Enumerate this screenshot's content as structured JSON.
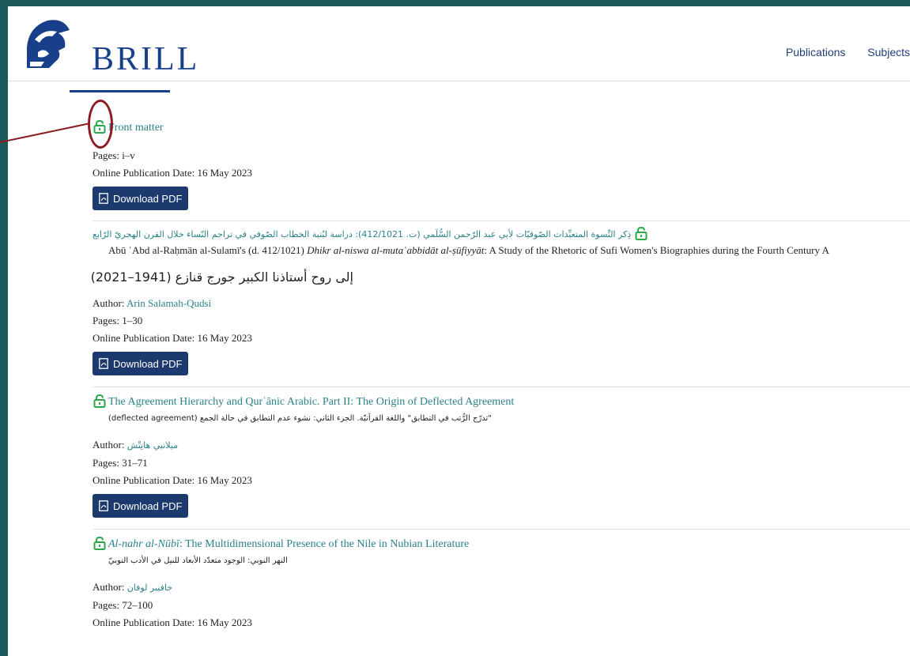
{
  "header": {
    "logo_text": "BRILL",
    "nav": [
      "Publications",
      "Subjects"
    ]
  },
  "entries": [
    {
      "title": "Front matter",
      "pages": "Pages:  i–v",
      "date": "Online Publication Date:  16 May 2023",
      "download_label": "Download PDF"
    },
    {
      "title_ar": "ذِكر النِّسوة المتعبِّدات الصّوفيّات لأبي عبد الرّحمن السُّلَمي (ت. 412/1021): دراسة لبُنية الخطاب الصّوفي في تراجم النّساء خلال القرن الهجريّ الرّابع",
      "subtitle": "Abū ʿAbd al-Raḥmān al-Sulamī's (d. 412/1021) ",
      "subtitle_italic": "Dhikr al-niswa al-mutaʿabbidāt al-ṣūfiyyāt",
      "subtitle_rest": ": A Study of the Rhetoric of Sufi Women's Biographies during the Fourth Century A",
      "dedication": "إلى روح أستاذنا الكبير جورج قنازع (1941–2021)",
      "author_label": "Author: ",
      "author": "Arin Salamah-Qudsi",
      "pages": "Pages:  1–30",
      "date": "Online Publication Date:  16 May 2023",
      "download_label": "Download PDF"
    },
    {
      "title": "The Agreement Hierarchy and Qurʾānic Arabic. Part II: The Origin of Deflected Agreement",
      "subtitle_ar": "\"تدرّج الرُّتب في التطابق\" واللغة القرآنيّة. الجزء الثاني: نشوء عدم التطابق في حالة الجمع (deflected agreement)",
      "author_label": "Author: ",
      "author": "ميلانبي هانِتْش",
      "pages": "Pages:  31–71",
      "date": "Online Publication Date:  16 May 2023",
      "download_label": "Download PDF"
    },
    {
      "title_italic": "Al-nahr al-Nūbī",
      "title_rest": ": The Multidimensional Presence of the Nile in Nubian Literature",
      "subtitle_ar": "النهر النوبي: الوجود متعدّد الأبعاد للنيل في الأدب النوبيّ",
      "author_label": "Author: ",
      "author": "خافيير لوفان",
      "pages": "Pages:  72–100",
      "date": "Online Publication Date:  16 May 2023"
    }
  ],
  "colors": {
    "background": "#1c5a5c",
    "link": "#2a8087",
    "button": "#1c3a6e",
    "annotation": "#8a1c22",
    "lock": "#2aa84a"
  }
}
